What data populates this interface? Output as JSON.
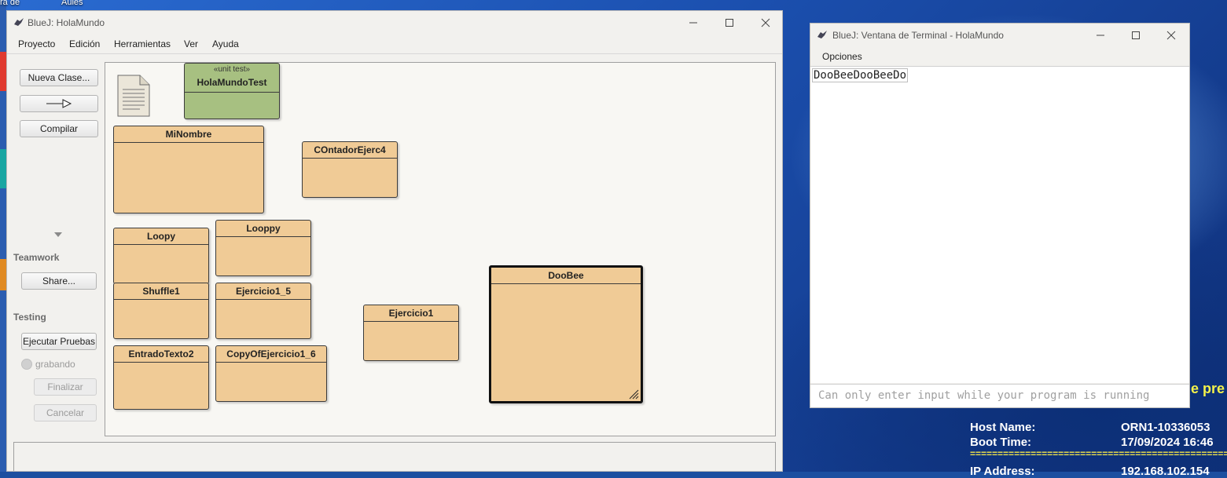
{
  "desktop": {
    "top_labels": [
      "ra de",
      "Aules"
    ],
    "yellow_text": "e pre",
    "info": {
      "host_label": "Host Name:",
      "host_value": "ORN1-10336053",
      "boot_label": "Boot Time:",
      "boot_value": "17/09/2024 16:46",
      "separator": "================================================",
      "ip_label": "IP Address:",
      "ip_value": "192.168.102.154"
    }
  },
  "main_window": {
    "title": "BlueJ: HolaMundo",
    "menu": [
      "Proyecto",
      "Edición",
      "Herramientas",
      "Ver",
      "Ayuda"
    ],
    "sidebar": {
      "new_class": "Nueva Clase...",
      "compile": "Compilar",
      "teamwork_label": "Teamwork",
      "share": "Share...",
      "testing_label": "Testing",
      "run_tests": "Ejecutar Pruebas",
      "recording": "grabando",
      "end": "Finalizar",
      "cancel": "Cancelar"
    },
    "classes": {
      "test_stereotype": "«unit test»",
      "test_class": "HolaMundoTest",
      "minombre": "MiNombre",
      "contador": "COntadorEjerc4",
      "loopy": "Loopy",
      "looppy": "Looppy",
      "shuffle1": "Shuffle1",
      "ejercicio1_5": "Ejercicio1_5",
      "entradotexto2": "EntradoTexto2",
      "copyofejercicio1_6": "CopyOfEjercicio1_6",
      "ejercicio1": "Ejercicio1",
      "doobee": "DooBee"
    }
  },
  "terminal_window": {
    "title": "BlueJ: Ventana de Terminal - HolaMundo",
    "menu": [
      "Opciones"
    ],
    "output_lines": [
      "DooBeeDooBeeDo"
    ],
    "input_placeholder": "Can only enter input while your program is running"
  },
  "colors": {
    "class_fill": "#f0cb96",
    "test_fill": "#a7c081",
    "canvas": "#f8f7f3"
  }
}
